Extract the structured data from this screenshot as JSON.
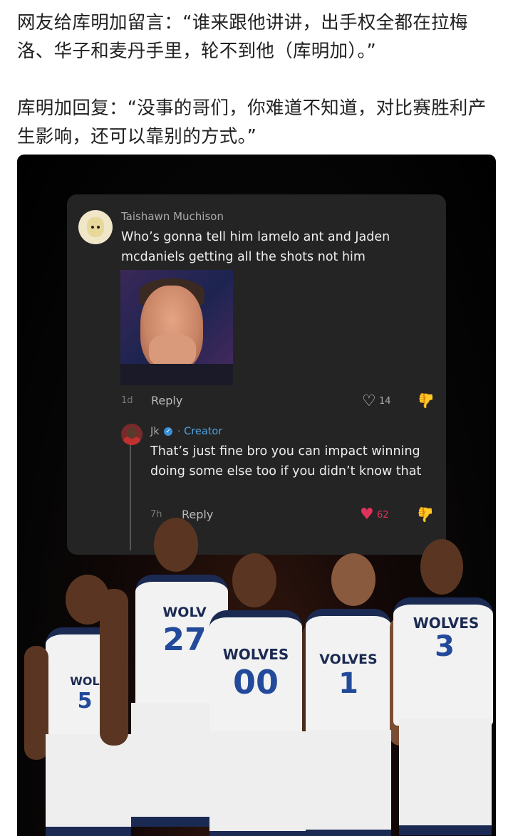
{
  "post": {
    "paragraph1": "网友给库明加留言：“谁来跟他讲讲，出手权全都在拉梅洛、华子和麦丹手里，轮不到他（库明加）。”",
    "paragraph2": "库明加回复：“没事的哥们，你难道不知道，对比赛胜利产生影响，还可以靠别的方式。”"
  },
  "comment": {
    "author": "Taishawn Muchison",
    "text": "Who’s gonna tell him lamelo ant and Jaden mcdaniels getting all the shots not him",
    "time": "1d",
    "reply_label": "Reply",
    "likes": "14"
  },
  "reply": {
    "author": "Jk",
    "badge": "Creator",
    "text": "That’s just fine bro you can impact winning doing some else too if you didn’t know that",
    "time": "7h",
    "reply_label": "Reply",
    "likes": "62"
  },
  "players": [
    {
      "team": "WOL",
      "number": "5"
    },
    {
      "team": "WOLV",
      "number": "27"
    },
    {
      "team": "WOLVES",
      "number": "00"
    },
    {
      "team": "VOLVES",
      "number": "1"
    },
    {
      "team": "WOLVES",
      "number": "3"
    }
  ],
  "colors": {
    "accent_blue": "#4fa3e0",
    "like_red": "#e0325a",
    "team_navy": "#1b2a52"
  }
}
